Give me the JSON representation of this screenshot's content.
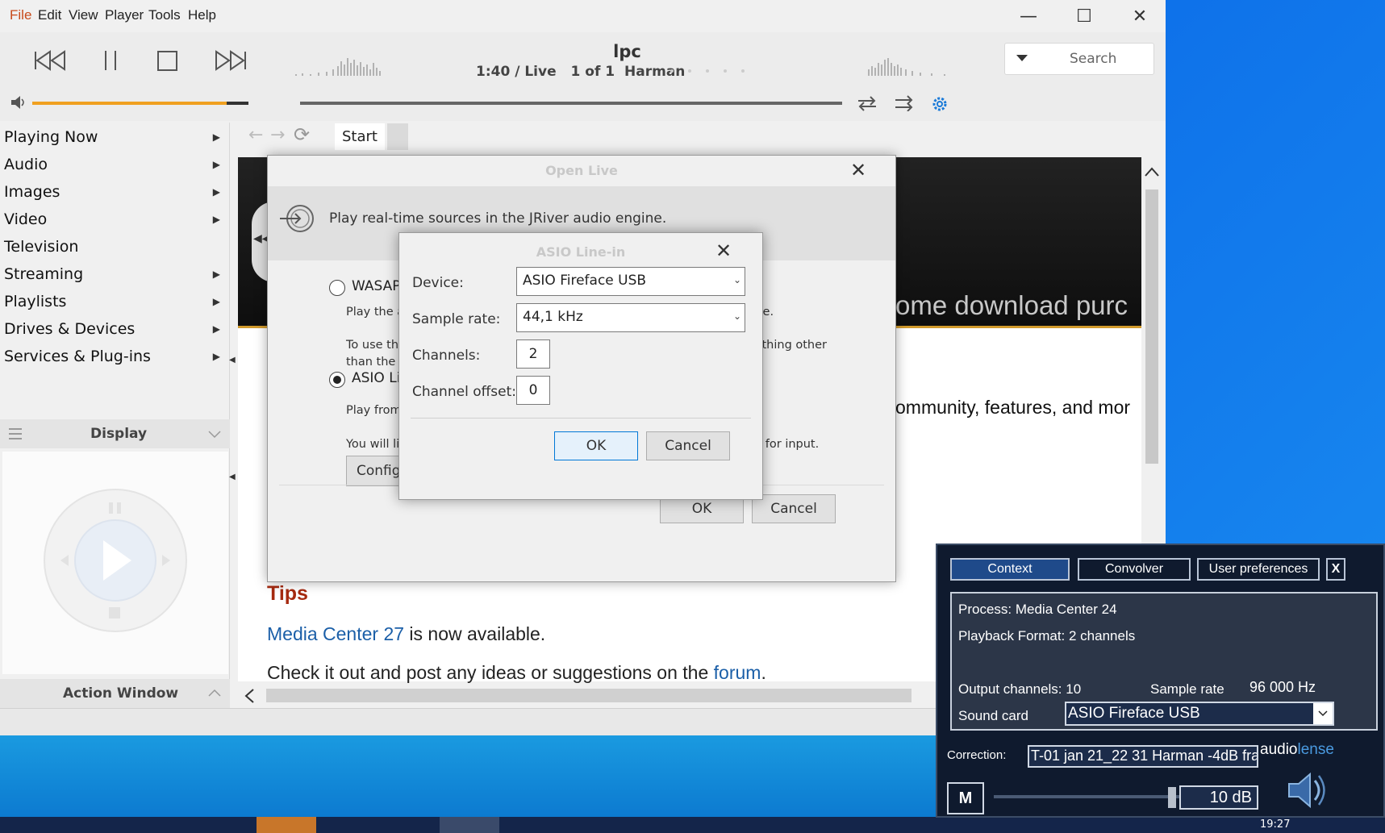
{
  "menu": {
    "file": "File",
    "edit": "Edit",
    "view": "View",
    "player": "Player",
    "tools": "Tools",
    "help": "Help"
  },
  "window_controls": {
    "minimize": "—",
    "maximize": "☐",
    "close": "✕"
  },
  "now_playing": {
    "title": "lpc",
    "time": "1:40 / Live",
    "position": "1 of 1",
    "artist": "Harman"
  },
  "search": {
    "placeholder": "Search"
  },
  "volume_level": 0.9,
  "sidebar": {
    "items": [
      {
        "label": "Playing Now",
        "submenu": true
      },
      {
        "label": "Audio",
        "submenu": true
      },
      {
        "label": "Images",
        "submenu": true
      },
      {
        "label": "Video",
        "submenu": true
      },
      {
        "label": "Television",
        "submenu": false
      },
      {
        "label": "Streaming",
        "submenu": true
      },
      {
        "label": "Playlists",
        "submenu": true
      },
      {
        "label": "Drives & Devices",
        "submenu": true
      },
      {
        "label": "Services & Plug-ins",
        "submenu": true
      }
    ],
    "display_label": "Display",
    "action_window_label": "Action Window"
  },
  "tabs": {
    "start": "Start"
  },
  "web": {
    "nav_text": "ome   download   purc",
    "community_text": "ommunity, features, and mor",
    "tips_heading": "Tips",
    "line1_link": "Media Center 27",
    "line1_rest": " is now available.",
    "line2_pre": "Check it out and post any ideas or suggestions on the ",
    "line2_link": "forum",
    "line2_post": "."
  },
  "open_live": {
    "title": "Open Live",
    "description": "Play real-time sources in the JRiver audio engine.",
    "wasapi_label": "WASAP",
    "wasapi_desc": "Play the a",
    "wasapi_desc_right": "engine.",
    "to_use_1": "To use thi",
    "to_use_1_right": "something other",
    "to_use_2": "than the c",
    "asio_label": "ASIO Li",
    "asio_desc": "Play from",
    "will_text": "You will li",
    "will_text_right": "using for input.",
    "configure_label": "Config",
    "ok": "OK",
    "cancel": "Cancel"
  },
  "asio_dialog": {
    "title": "ASIO Line-in",
    "device_label": "Device:",
    "device_value": "ASIO Fireface USB",
    "sample_rate_label": "Sample rate:",
    "sample_rate_value": "44,1 kHz",
    "channels_label": "Channels:",
    "channels_value": "2",
    "offset_label": "Channel offset:",
    "offset_value": "0",
    "ok": "OK",
    "cancel": "Cancel"
  },
  "audiolense": {
    "tabs": [
      "Context",
      "Convolver",
      "User preferences"
    ],
    "close": "X",
    "process": "Process: Media Center 24",
    "playback_format": "Playback Format: 2 channels",
    "output_channels": "Output channels: 10",
    "sample_rate_label": "Sample rate",
    "sample_rate_value": "96 000 Hz",
    "sound_card_label": "Sound card",
    "sound_card_value": "ASIO Fireface USB",
    "correction_label": "Correction:",
    "correction_value": "T-01 jan 21_22 31 Harman -4dB fra",
    "logo_1": "audio",
    "logo_2": "lense",
    "mute": "M",
    "gain_value": "10 dB"
  },
  "clock": "19:27",
  "colors": {
    "accent_orange": "#f0a020",
    "menu_file": "#c84a1a",
    "tips_red": "#a62a10",
    "link_blue": "#1b5fa8",
    "settings_blue": "#1a7ad8",
    "al_bg": "#0f1a2e",
    "al_selected": "#1f4a8a"
  }
}
